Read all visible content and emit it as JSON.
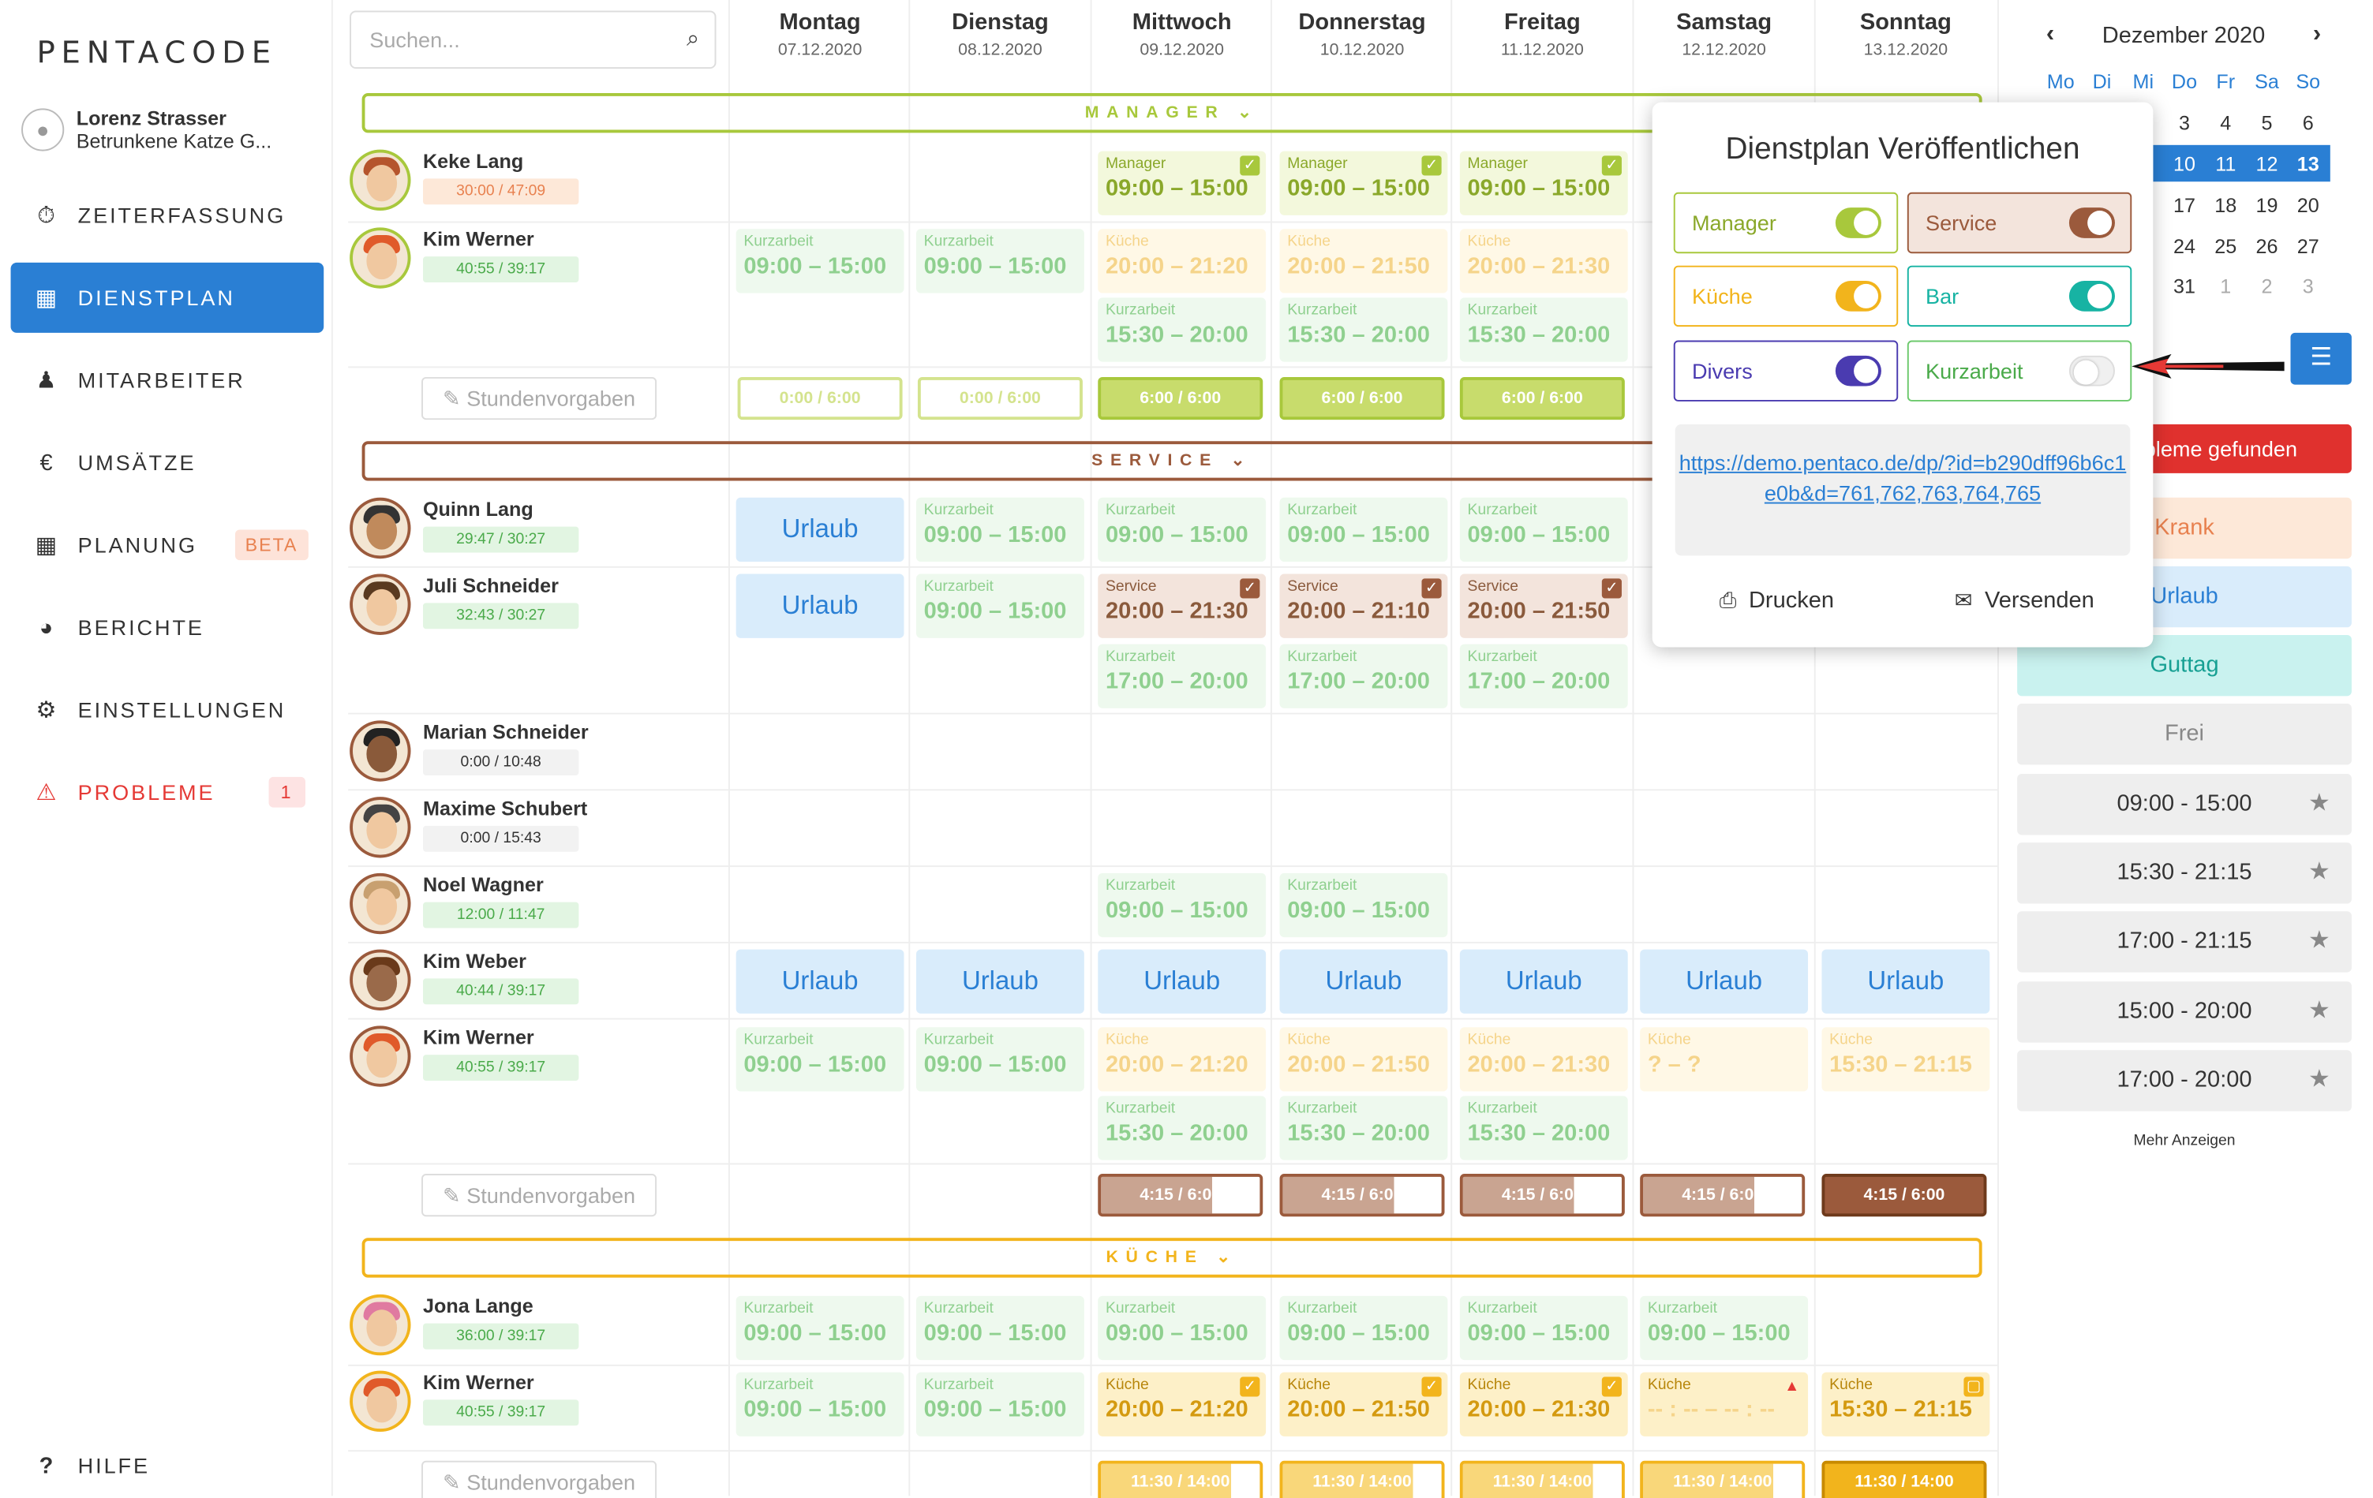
{
  "app": {
    "logo": "PENTACODE",
    "user_name": "Lorenz Strasser",
    "user_company": "Betrunkene Katze G..."
  },
  "nav": [
    {
      "label": "ZEITERFASSUNG",
      "icon": "stopwatch-icon",
      "glyph": "⏱"
    },
    {
      "label": "DIENSTPLAN",
      "icon": "table-icon",
      "glyph": "▦",
      "active": true
    },
    {
      "label": "MITARBEITER",
      "icon": "users-icon",
      "glyph": "👥"
    },
    {
      "label": "UMSÄTZE",
      "icon": "euro-icon",
      "glyph": "€"
    },
    {
      "label": "PLANUNG",
      "icon": "calendar-icon",
      "glyph": "▦",
      "badge": "BETA"
    },
    {
      "label": "BERICHTE",
      "icon": "pie-chart-icon",
      "glyph": "◕"
    },
    {
      "label": "EINSTELLUNGEN",
      "icon": "gear-icon",
      "glyph": "⚙"
    },
    {
      "label": "PROBLEME",
      "icon": "warning-icon",
      "glyph": "⚠",
      "badge": "1"
    }
  ],
  "help": "HILFE",
  "search": {
    "placeholder": "Suchen..."
  },
  "days": [
    {
      "name": "Montag",
      "date": "07.12.2020"
    },
    {
      "name": "Dienstag",
      "date": "08.12.2020"
    },
    {
      "name": "Mittwoch",
      "date": "09.12.2020"
    },
    {
      "name": "Donnerstag",
      "date": "10.12.2020"
    },
    {
      "name": "Freitag",
      "date": "11.12.2020"
    },
    {
      "name": "Samstag",
      "date": "12.12.2020"
    },
    {
      "name": "Sonntag",
      "date": "13.12.2020"
    }
  ],
  "sections": {
    "manager": "MANAGER",
    "service": "SERVICE",
    "kueche": "KÜCHE"
  },
  "colors": {
    "manager": "#a8c83c",
    "service": "#9b5a3c",
    "kueche": "#f2b41c",
    "kurzarbeit": "#6cc96c",
    "blue": "#2a7fd4"
  },
  "stundenvorgaben": "Stundenvorgaben",
  "urlaub": "Urlaub",
  "employees": {
    "keke": {
      "name": "Keke Lang",
      "hours": "30:00 / 47:09"
    },
    "kim1": {
      "name": "Kim Werner",
      "hours": "40:55 / 39:17"
    },
    "quinn": {
      "name": "Quinn Lang",
      "hours": "29:47 / 30:27"
    },
    "juli": {
      "name": "Juli Schneider",
      "hours": "32:43 / 30:27"
    },
    "marian": {
      "name": "Marian Schneider",
      "hours": "0:00 / 10:48"
    },
    "maxime": {
      "name": "Maxime Schubert",
      "hours": "0:00 / 15:43"
    },
    "noel": {
      "name": "Noel Wagner",
      "hours": "12:00 / 11:47"
    },
    "kimweber": {
      "name": "Kim Weber",
      "hours": "40:44 / 39:17"
    },
    "kim2": {
      "name": "Kim Werner",
      "hours": "40:55 / 39:17"
    },
    "jona": {
      "name": "Jona Lange",
      "hours": "36:00 / 39:17"
    },
    "kim3": {
      "name": "Kim Werner",
      "hours": "40:55 / 39:17"
    }
  },
  "shift_labels": {
    "manager": "Manager",
    "kurzarbeit": "Kurzarbeit",
    "kueche": "Küche",
    "service": "Service"
  },
  "times": {
    "t0915": "09:00 – 15:00",
    "t2021": "20:00 – 21:20",
    "t2050": "20:00 – 21:50",
    "t2030": "20:00 – 21:30",
    "t1520": "15:30 – 20:00",
    "t2021b": "20:00 – 21:30",
    "t2110": "20:00 – 21:10",
    "t2150": "20:00 – 21:50",
    "t1720": "17:00 – 20:00",
    "tq": "? – ?",
    "t1521": "15:30 – 21:15",
    "tdash": "-- : -- – -- : --"
  },
  "hourboxes": {
    "m1": "0:00 / 6:00",
    "m2": "6:00 / 6:00",
    "s": "4:15 / 6:00",
    "k": "11:30 / 14:00"
  },
  "calendar": {
    "month": "Dezember 2020",
    "weekdays": [
      "Mo",
      "Di",
      "Mi",
      "Do",
      "Fr",
      "Sa",
      "So"
    ],
    "rows": [
      [
        "",
        "",
        "",
        "3",
        "4",
        "5",
        "6"
      ],
      [
        "",
        "",
        "",
        "10",
        "11",
        "12",
        "13"
      ],
      [
        "",
        "",
        "",
        "17",
        "18",
        "19",
        "20"
      ],
      [
        "",
        "",
        "",
        "24",
        "25",
        "26",
        "27"
      ],
      [
        "",
        "",
        "",
        "31",
        "1",
        "2",
        "3"
      ]
    ]
  },
  "right_panel": {
    "problems": "bleme gefunden",
    "krank": "Krank",
    "urlaub": "Urlaub",
    "guttag": "Guttag",
    "frei": "Frei",
    "presets": [
      "09:00 - 15:00",
      "15:30 - 21:15",
      "17:00 - 21:15",
      "15:00 - 20:00",
      "17:00 - 20:00"
    ],
    "more": "Mehr Anzeigen"
  },
  "popup": {
    "title": "Dienstplan Veröffentlichen",
    "toggles": [
      {
        "label": "Manager",
        "on": true,
        "color": "#a8c83c"
      },
      {
        "label": "Service",
        "on": true,
        "color": "#9b5a3c"
      },
      {
        "label": "Küche",
        "on": true,
        "color": "#f2b41c"
      },
      {
        "label": "Bar",
        "on": true,
        "color": "#17b3a3"
      },
      {
        "label": "Divers",
        "on": true,
        "color": "#4a3bb0"
      },
      {
        "label": "Kurzarbeit",
        "on": false,
        "color": "#6cc96c"
      }
    ],
    "link": "https://demo.pentaco.de/dp/?id=b290dff96b6c1e0b&d=761,762,763,764,765",
    "print": "Drucken",
    "send": "Versenden"
  }
}
